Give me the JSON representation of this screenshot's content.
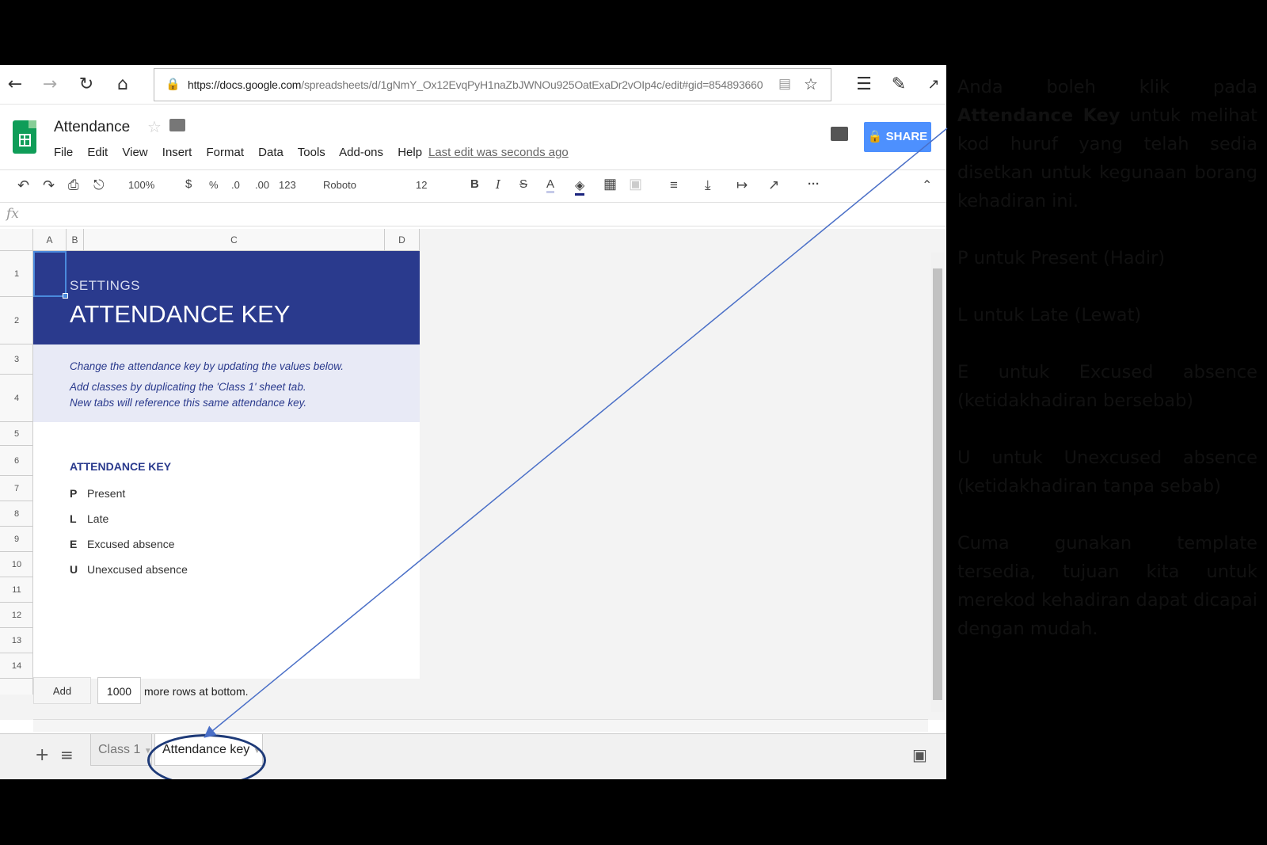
{
  "browser": {
    "url": {
      "host": "https://docs.google.com",
      "path": "/spreadsheets/d/1gNmY_Ox12EvqPyH1naZbJWNOu925OatExaDr2vOIp4c/edit#gid=854893660"
    }
  },
  "header": {
    "title": "Attendance",
    "menu": [
      "File",
      "Edit",
      "View",
      "Insert",
      "Format",
      "Data",
      "Tools",
      "Add-ons",
      "Help"
    ],
    "last_edit": "Last edit was seconds ago",
    "share_label": "SHARE"
  },
  "toolbar": {
    "zoom": "100%",
    "currency": "$",
    "percent": "%",
    "dec_less": ".0",
    "dec_more": ".00",
    "format_more": "123",
    "font": "Roboto",
    "font_size": "12",
    "bold": "B",
    "italic": "I",
    "strike": "S",
    "text_color": "A",
    "more": "···"
  },
  "formula_bar": {
    "fx": "fx"
  },
  "columns": [
    "A",
    "B",
    "C",
    "D"
  ],
  "rows": [
    "1",
    "2",
    "3",
    "4",
    "5",
    "6",
    "7",
    "8",
    "9",
    "10",
    "11",
    "12",
    "13",
    "14"
  ],
  "sheet": {
    "settings_label": "SETTINGS",
    "banner_title": "ATTENDANCE KEY",
    "info_lines": [
      "Change the attendance key by updating the values below.",
      "Add classes by duplicating the 'Class 1' sheet tab.",
      "New tabs will reference this same attendance key."
    ],
    "key_heading": "ATTENDANCE KEY",
    "keys": [
      {
        "code": "P",
        "label": "Present"
      },
      {
        "code": "L",
        "label": "Late"
      },
      {
        "code": "E",
        "label": "Excused absence"
      },
      {
        "code": "U",
        "label": "Unexcused absence"
      }
    ]
  },
  "add_rows": {
    "button": "Add",
    "count": "1000",
    "suffix": "more rows at bottom."
  },
  "tabs": [
    {
      "label": "Class 1",
      "active": false
    },
    {
      "label": "Attendance key",
      "active": true
    }
  ],
  "colors": {
    "banner": "#2a3a8d",
    "info_band": "#e8eaf6",
    "share": "#4d90fe",
    "sheets_green": "#0f9d58",
    "annotation_ring": "#1e3a78"
  },
  "annotation": {
    "p1_prefix": "Anda boleh klik pada",
    "p1_bold": "Attendance Key",
    "p1_suffix": "untuk melihat kod huruf yang telah sedia disetkan untuk kegunaan borang kehadiran ini.",
    "p2": "P untuk Present (Hadir)",
    "p3": "L untuk Late (Lewat)",
    "p4": "E untuk Excused absence (ketidakhadiran bersebab)",
    "p5": "U untuk Unexcused absence (ketidakhadiran tanpa sebab)",
    "p6": "Cuma gunakan template tersedia, tujuan kita untuk merekod kehadiran dapat dicapai dengan mudah."
  }
}
